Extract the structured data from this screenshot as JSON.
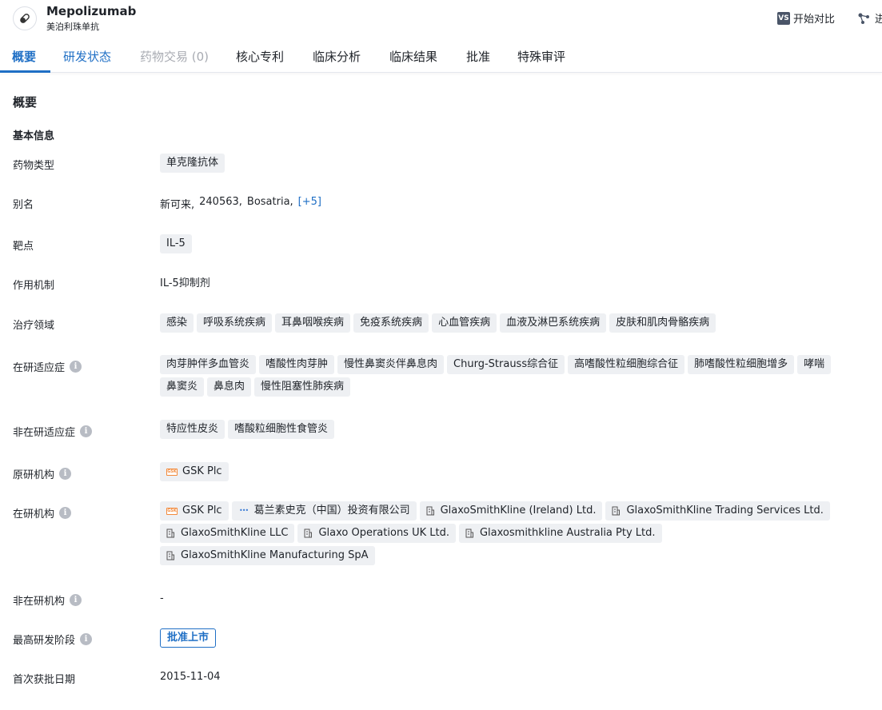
{
  "header": {
    "drug_name": "Mepolizumab",
    "drug_name_cn": "美泊利珠单抗",
    "compare_badge": "VS",
    "compare_label": "开始对比",
    "second_btn_label": "进"
  },
  "tabs": [
    {
      "label": "概要"
    },
    {
      "label": "研发状态"
    },
    {
      "label": "药物交易 (0)"
    },
    {
      "label": "核心专利"
    },
    {
      "label": "临床分析"
    },
    {
      "label": "临床结果"
    },
    {
      "label": "批准"
    },
    {
      "label": "特殊审评"
    }
  ],
  "overview": {
    "section_title": "概要",
    "basic_info_title": "基本信息",
    "drug_type": {
      "label": "药物类型",
      "tags": [
        "单克隆抗体"
      ]
    },
    "aliases": {
      "label": "别名",
      "values": [
        "新可来,",
        "240563,",
        "Bosatria,"
      ],
      "more": "[+5]"
    },
    "target": {
      "label": "靶点",
      "tags": [
        "IL-5"
      ]
    },
    "mechanism": {
      "label": "作用机制",
      "value": "IL-5抑制剂"
    },
    "therapy_area": {
      "label": "治疗领域",
      "tags": [
        "感染",
        "呼吸系统疾病",
        "耳鼻咽喉疾病",
        "免疫系统疾病",
        "心血管疾病",
        "血液及淋巴系统疾病",
        "皮肤和肌肉骨骼疾病"
      ]
    },
    "active_indications": {
      "label": "在研适应症",
      "tags": [
        "肉芽肿伴多血管炎",
        "嗜酸性肉芽肿",
        "慢性鼻窦炎伴鼻息肉",
        "Churg-Strauss综合征",
        "高嗜酸性粒细胞综合征",
        "肺嗜酸性粒细胞增多",
        "哮喘",
        "鼻窦炎",
        "鼻息肉",
        "慢性阻塞性肺疾病"
      ]
    },
    "inactive_indications": {
      "label": "非在研适应症",
      "tags": [
        "特应性皮炎",
        "嗜酸粒细胞性食管炎"
      ]
    },
    "originator": {
      "label": "原研机构",
      "orgs": [
        {
          "name": "GSK Plc",
          "icon": "gsk-logo"
        }
      ]
    },
    "active_orgs": {
      "label": "在研机构",
      "orgs": [
        {
          "name": "GSK Plc",
          "icon": "gsk-logo"
        },
        {
          "name": "葛兰素史克（中国）投资有限公司",
          "icon": "dots-logo"
        },
        {
          "name": "GlaxoSmithKline (Ireland) Ltd.",
          "icon": "building-icon"
        },
        {
          "name": "GlaxoSmithKline Trading Services Ltd.",
          "icon": "building-icon"
        },
        {
          "name": "GlaxoSmithKline LLC",
          "icon": "building-icon"
        },
        {
          "name": "Glaxo Operations UK Ltd.",
          "icon": "building-icon"
        },
        {
          "name": "Glaxosmithkline Australia Pty Ltd.",
          "icon": "building-icon"
        },
        {
          "name": "GlaxoSmithKline Manufacturing SpA",
          "icon": "building-icon"
        }
      ]
    },
    "inactive_orgs": {
      "label": "非在研机构",
      "value": "-"
    },
    "highest_phase": {
      "label": "最高研发阶段",
      "value": "批准上市"
    },
    "first_approval": {
      "label": "首次获批日期",
      "value": "2015-11-04"
    },
    "info_glyph": "i",
    "gsk_glyph": "GSK",
    "dots_glyph": "•••"
  },
  "colors": {
    "accent": "#1f6fc5",
    "tag_bg": "#eef0f3",
    "disabled": "#a8abb2"
  }
}
